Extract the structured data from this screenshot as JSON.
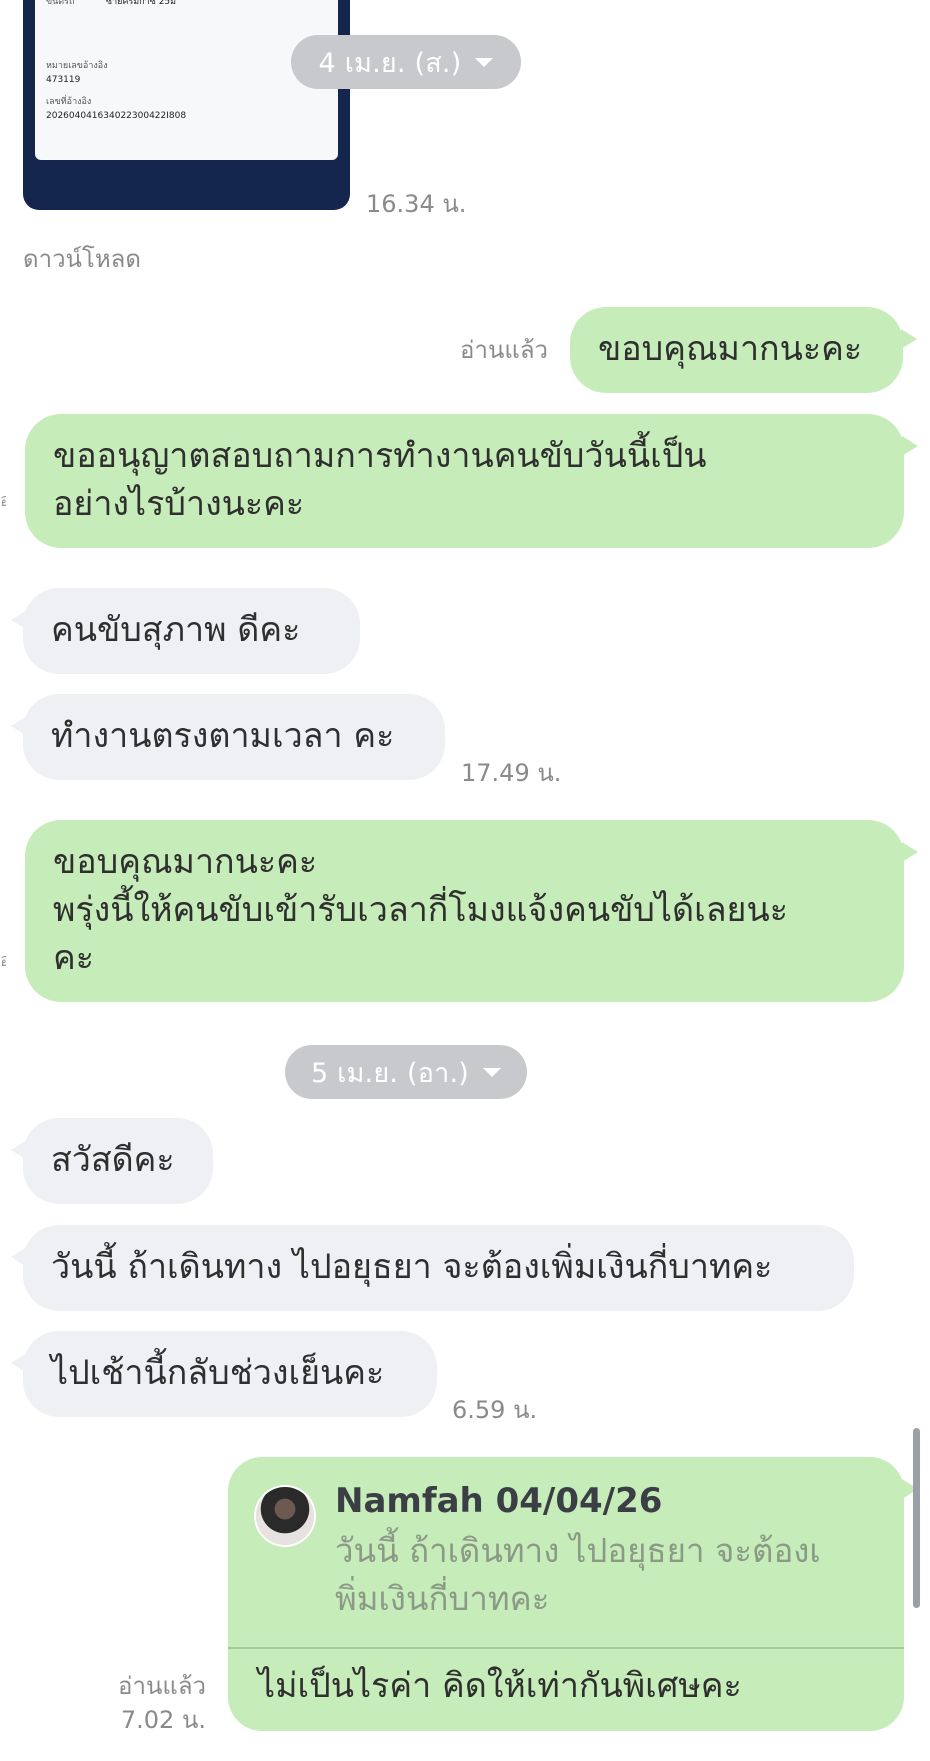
{
  "image_message": {
    "label_1": "ขนิดรถ",
    "value_1": "ซ้ายครีมก๊าซ 25ม",
    "label_2": "หมายเลขอ้างอิง",
    "value_2": "473119",
    "label_3": "เลขที่อ้างอิง",
    "value_3": "202604041634022300422I808",
    "time": "16.34 น.",
    "download_label": "ดาวน์โหลด"
  },
  "date_chips": [
    "4 เม.ย. (ส.)",
    "5 เม.ย. (อา.)"
  ],
  "messages": [
    {
      "side": "out",
      "text": "ขอบคุณมากนะคะ",
      "read": "อ่านแล้ว"
    },
    {
      "side": "out",
      "text": "ขออนุญาตสอบถามการทำงานคนขับวันนี้เป็น\nอย่างไรบ้างนะคะ"
    },
    {
      "side": "in",
      "text": "คนขับสุภาพ ดีคะ"
    },
    {
      "side": "in",
      "text": "ทำงานตรงตามเวลา คะ",
      "time": "17.49 น."
    },
    {
      "side": "out",
      "text": "ขอบคุณมากนะคะ\nพรุ่งนี้ให้คนขับเข้ารับเวลากี่โมงแจ้งคนขับได้เลยนะ\nคะ"
    },
    {
      "side": "in",
      "text": "สวัสดีคะ"
    },
    {
      "side": "in",
      "text": "วันนี้ ถ้าเดินทาง ไปอยุธยา จะต้องเพิ่มเงินกี่บาทคะ"
    },
    {
      "side": "in",
      "text": "ไปเช้านี้กลับช่วงเย็นคะ",
      "time": "6.59 น."
    }
  ],
  "reply": {
    "name": "Namfah 04/04/26",
    "quoted": "วันนี้ ถ้าเดินทาง ไปอยุธยา จะต้องเ\nพิ่มเงินกี่บาทคะ",
    "text": "ไม่เป็นไรค่า คิดให้เท่ากันพิเศษคะ",
    "read": "อ่านแล้ว",
    "time": "7.02 น."
  },
  "colors": {
    "incoming_bubble": "#eef0f3",
    "outgoing_bubble": "#c6ecb9",
    "date_chip": "#c8c9cc"
  }
}
